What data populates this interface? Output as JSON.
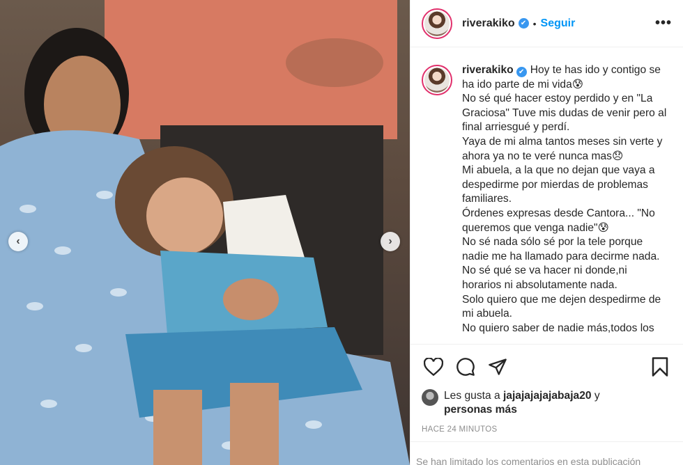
{
  "post": {
    "username": "riverakiko",
    "verified_glyph": "✔",
    "dot": "•",
    "follow_label": "Seguir",
    "more_label": "•••",
    "caption_text": "Hoy te has ido y contigo se ha ido parte de mi vida😰\nNo sé qué hacer estoy perdido y en \"La Graciosa\" Tuve mis dudas de venir pero al final arriesgué y perdí.\nYaya de mi alma tantos meses sin verte y ahora ya no te veré nunca mas😞\nMi abuela, a la que no dejan que vaya a despedirme por mierdas de problemas familiares.\nÓrdenes expresas desde Cantora... \"No queremos que venga nadie\"😰\nNo sé nada sólo sé por la tele porque nadie me ha llamado para decirme nada.\nNo sé qué se va hacer ni donde,ni horarios ni absolutamente nada.\nSolo quiero que me dejen despedirme de mi abuela.\nNo quiero saber de nadie más,todos los",
    "likes_prefix": "Les gusta a ",
    "likes_user": "jajajajajajabaja20",
    "likes_and": " y",
    "likes_others": "personas más",
    "timestamp": "HACE 24 MINUTOS",
    "comments_disabled": "Se han limitado los comentarios en esta publicación"
  },
  "icons": {
    "like": "heart-icon",
    "comment": "comment-icon",
    "share": "send-icon",
    "save": "bookmark-icon",
    "prev": "chevron-left-icon",
    "next": "chevron-right-icon"
  },
  "carousel": {
    "prev_glyph": "‹",
    "next_glyph": "›"
  },
  "colors": {
    "accent": "#0095f6",
    "verified": "#3897f0",
    "text": "#262626",
    "muted": "#8e8e8e",
    "ring": "#e1306c"
  }
}
